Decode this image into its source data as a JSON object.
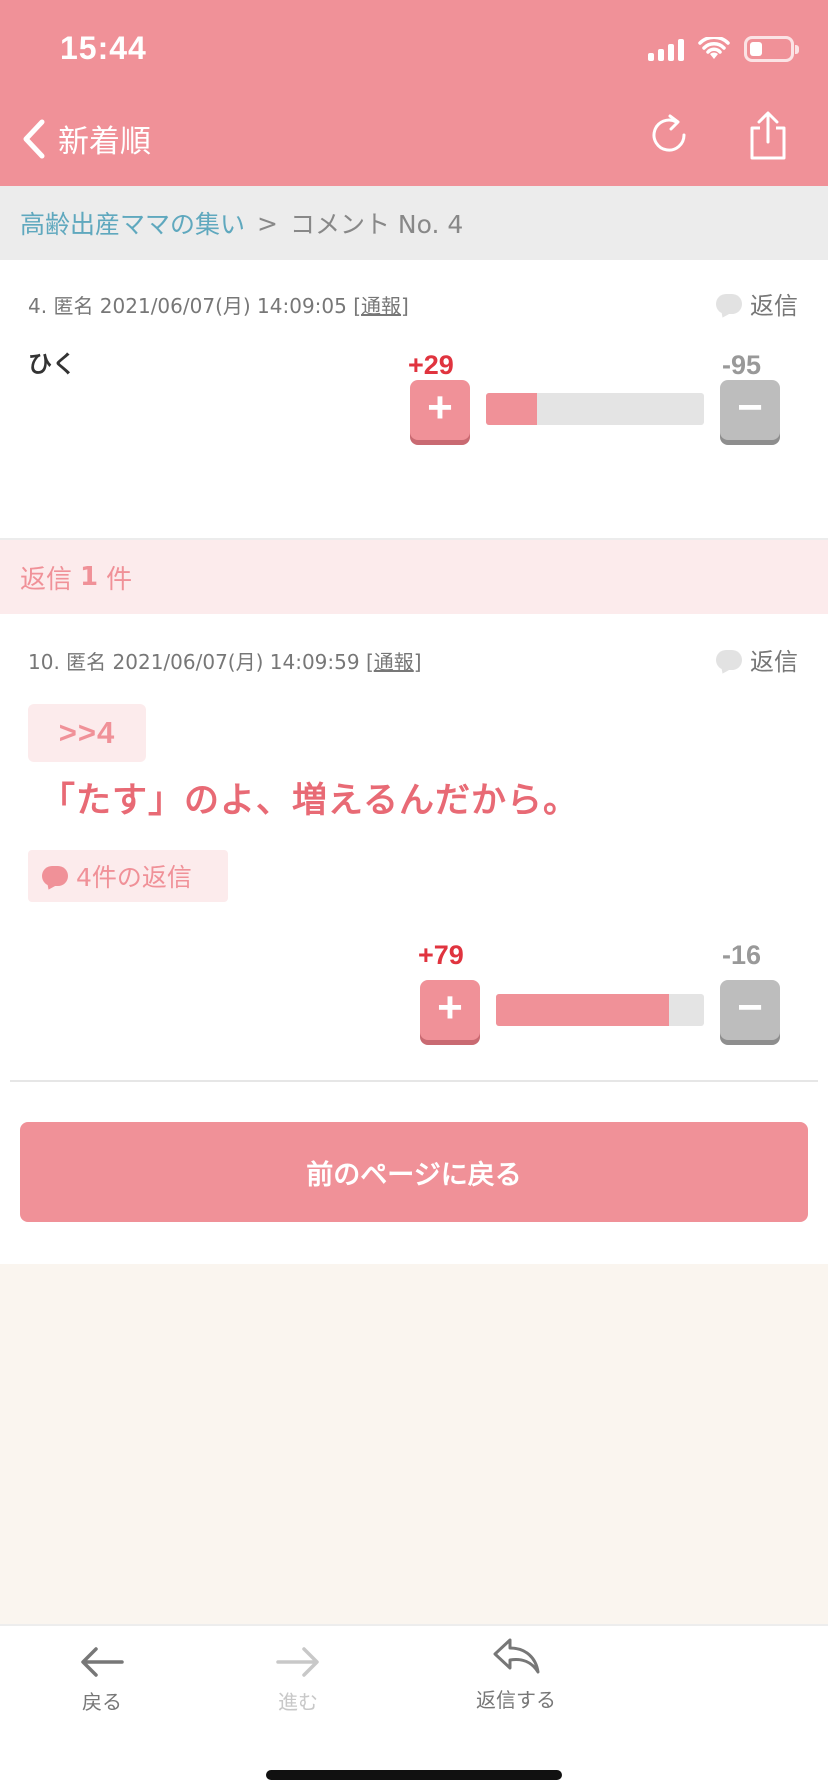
{
  "status_bar": {
    "time": "15:44"
  },
  "nav": {
    "back_label": "新着順"
  },
  "breadcrumb": {
    "link": "高齢出産ママの集い",
    "separator": ">",
    "current": "コメント No. 4"
  },
  "comment_main": {
    "meta_prefix": "4. 匿名 2021/06/07(月) 14:09:05 [",
    "report_label": "通報",
    "meta_suffix": "]",
    "reply_label": "返信",
    "body": "ひく",
    "plus_count": "+29",
    "minus_count": "-95",
    "plus_ratio": 0.234
  },
  "replies_header": {
    "prefix": "返信",
    "count": "1",
    "suffix": "件"
  },
  "comment_reply": {
    "meta_prefix": "10. 匿名 2021/06/07(月) 14:09:59 [",
    "report_label": "通報",
    "meta_suffix": "]",
    "reply_label": "返信",
    "anchor": ">>4",
    "body": "「たす」のよ、増えるんだから。",
    "reply_count_label": "4件の返信",
    "plus_count": "+79",
    "minus_count": "-16",
    "plus_ratio": 0.832
  },
  "back_page_button": "前のページに戻る",
  "toolbar": {
    "back": "戻る",
    "forward": "進む",
    "reply": "返信する"
  },
  "colors": {
    "accent": "#f09198",
    "plus": "#e0343f",
    "link": "#5fa8be",
    "background": "#faf5ef"
  }
}
